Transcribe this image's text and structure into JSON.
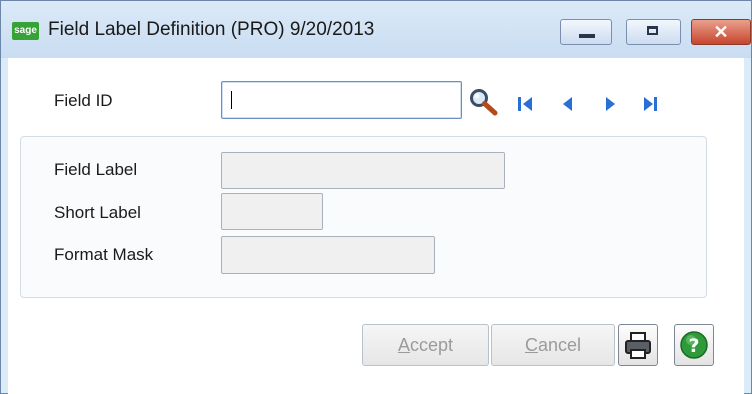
{
  "window": {
    "title": "Field Label Definition (PRO) 9/20/2013",
    "logo_text": "sage",
    "minimize_icon": "minimize-icon",
    "maximize_icon": "maximize-icon",
    "close_glyph": "✕"
  },
  "form": {
    "field_id": {
      "label": "Field ID",
      "value": ""
    },
    "field_label": {
      "label": "Field Label",
      "value": ""
    },
    "short_label": {
      "label": "Short Label",
      "value": ""
    },
    "format_mask": {
      "label": "Format Mask",
      "value": ""
    }
  },
  "nav": {
    "lookup_icon": "magnifier-icon",
    "first_icon": "first-record-icon",
    "prev_icon": "previous-record-icon",
    "next_icon": "next-record-icon",
    "last_icon": "last-record-icon"
  },
  "buttons": {
    "accept_first": "A",
    "accept_rest": "ccept",
    "cancel_first": "C",
    "cancel_rest": "ancel",
    "print_icon": "printer-icon",
    "help_icon": "help-icon",
    "help_glyph": "?"
  },
  "colors": {
    "nav_blue": "#2a6fd6",
    "help_green": "#2e9a3a",
    "sage_green": "#35a335"
  }
}
